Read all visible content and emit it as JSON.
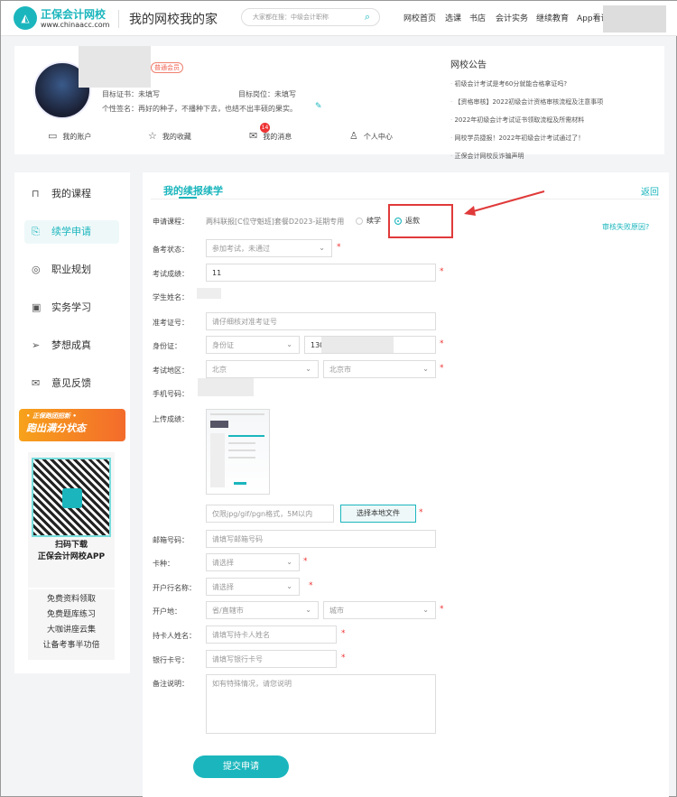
{
  "header": {
    "logo_title": "正保会计网校",
    "logo_url": "www.chinaacc.com",
    "site_title": "我的网校我的家",
    "search_placeholder": "大家都在搜：中级会计职称",
    "nav": [
      "网校首页",
      "选课",
      "书店",
      "会计实务",
      "继续教育",
      "App看课"
    ]
  },
  "profile": {
    "member_badge": "普通会员",
    "target_cert": "目标证书：未填写",
    "target_job": "目标岗位：未填写",
    "signature": "个性签名：再好的种子，不播种下去，也结不出丰硕的果实。",
    "links": [
      "我的账户",
      "我的收藏",
      "我的消息",
      "个人中心"
    ],
    "message_count": "14"
  },
  "notice": {
    "title": "网校公告",
    "items": [
      "初级会计考试是考60分就能合格拿证吗?",
      "【资格审核】2022初级会计资格审核流程及注意事项",
      "2022年初级会计考试证书领取流程及所需材料",
      "网校学员捷报！2022年初级会计考试通过了！",
      "正保会计网校反诈骗声明"
    ]
  },
  "sidebar": {
    "items": [
      "我的课程",
      "续学申请",
      "职业规划",
      "实务学习",
      "梦想成真",
      "意见反馈"
    ],
    "active": 1,
    "banner_top": "• 正保跑团招新 •",
    "banner_main": "跑出满分状态",
    "qr_line1": "扫码下载",
    "qr_line2": "正保会计网校APP",
    "links": [
      "免费资料领取",
      "免费题库练习",
      "大咖讲座云集",
      "让备考事半功倍"
    ]
  },
  "main": {
    "tab": "我的续报续学",
    "back": "返回",
    "fail_reason": "审核失败原因?",
    "course_label": "申请课程：",
    "course_value": "两科联报[C位守魁班]套餐D2023-延期专用",
    "radio_options": [
      "续学",
      "返款"
    ],
    "radio_selected": 1,
    "fields": {
      "status": {
        "label": "备考状态：",
        "value": "参加考试，未通过"
      },
      "score": {
        "label": "考试成绩：",
        "value": "11"
      },
      "name": {
        "label": "学生姓名："
      },
      "ticket": {
        "label": "准考证号：",
        "placeholder": "请仔细核对准考证号"
      },
      "id": {
        "label": "身份证：",
        "type": "身份证",
        "value": "130"
      },
      "region": {
        "label": "考试地区：",
        "province": "北京",
        "city": "北京市"
      },
      "phone": {
        "label": "手机号码："
      },
      "upload": {
        "label": "上传成绩：",
        "placeholder": "仅限jpg/gif/pgn格式，5M以内",
        "button": "选择本地文件"
      },
      "email": {
        "label": "邮箱号码：",
        "placeholder": "请填写邮箱号码"
      },
      "card_type": {
        "label": "卡种：",
        "value": "请选择"
      },
      "bank": {
        "label": "开户行名称：",
        "value": "请选择"
      },
      "bank_loc": {
        "label": "开户地：",
        "province": "省/直辖市",
        "city": "城市"
      },
      "holder": {
        "label": "持卡人姓名：",
        "placeholder": "请填写持卡人姓名"
      },
      "card_no": {
        "label": "银行卡号：",
        "placeholder": "请填写银行卡号"
      },
      "remark": {
        "label": "备注说明：",
        "placeholder": "如有特殊情况，请您说明"
      }
    },
    "submit": "提交申请"
  },
  "colors": {
    "accent": "#1bb6bd",
    "highlight": "#e03a3a"
  }
}
